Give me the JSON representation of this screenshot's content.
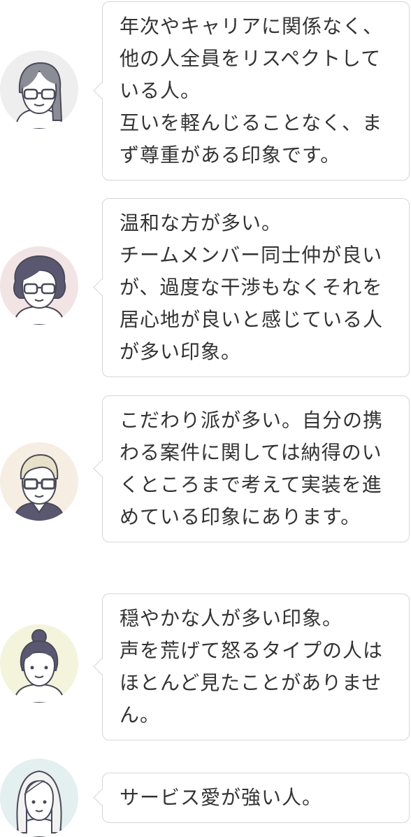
{
  "testimonials": [
    {
      "text": "年次やキャリアに関係なく、他の人全員をリスペクトしている人。\n互いを軽んじることなく、まず尊重がある印象です。",
      "avatar": {
        "bg": "#efeeee",
        "icon": "woman-glasses-long-hair-icon"
      }
    },
    {
      "text": "温和な方が多い。\nチームメンバー同士仲が良いが、過度な干渉もなくそれを居心地が良いと感じている人が多い印象。",
      "avatar": {
        "bg": "#f2e4e4",
        "icon": "woman-glasses-curly-hair-icon"
      }
    },
    {
      "text": "こだわり派が多い。自分の携わる案件に関しては納得のいくところまで考えて実装を進めている印象にあります。",
      "avatar": {
        "bg": "#f6eee3",
        "icon": "man-glasses-icon"
      }
    },
    {
      "text": "穏やかな人が多い印象。\n声を荒げて怒るタイプの人はほとんど見たことがありません。",
      "avatar": {
        "bg": "#f4f3dc",
        "icon": "woman-bun-hair-icon"
      }
    },
    {
      "text": "サービス愛が強い人。",
      "avatar": {
        "bg": "#e4efef",
        "icon": "woman-long-hair-icon"
      }
    }
  ]
}
